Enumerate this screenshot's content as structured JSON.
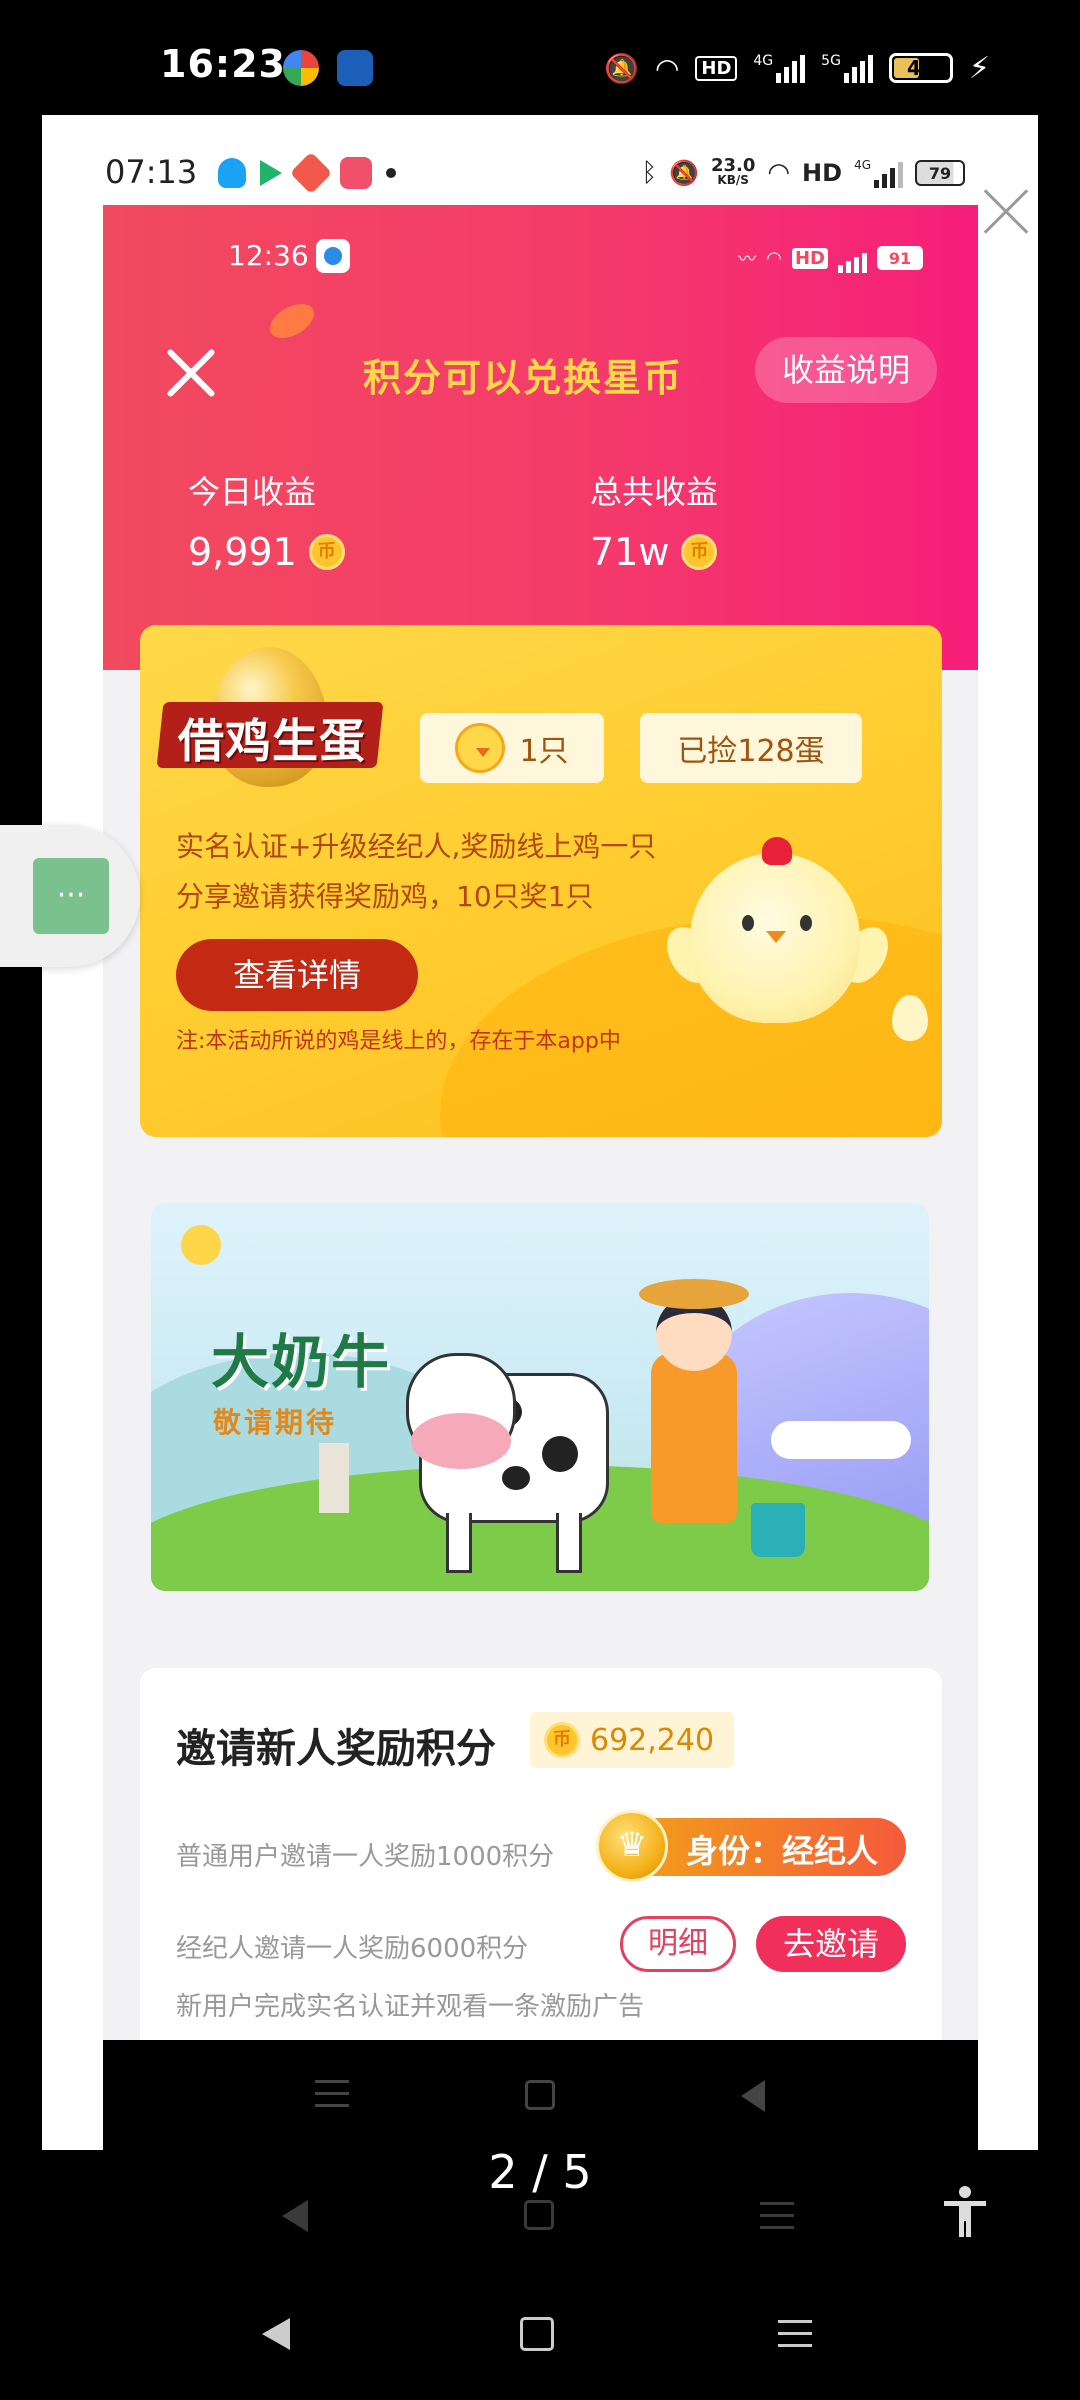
{
  "device_status": {
    "time": "16:23",
    "hd_label": "HD",
    "net_4g": "4G",
    "net_5g": "5G",
    "battery": "46"
  },
  "nested_status": {
    "time": "07:13",
    "speed": "23.0",
    "speed_unit": "KB/S",
    "hd_label": "HD",
    "net": "4G",
    "battery": "79"
  },
  "app_status": {
    "time": "12:36",
    "battery": "91"
  },
  "header": {
    "title": "积分可以兑换星币",
    "earnings_button": "收益说明"
  },
  "stats": {
    "today_label": "今日收益",
    "today_value": "9,991",
    "total_label": "总共收益",
    "total_value": "71w",
    "coin_glyph": "币"
  },
  "egg_card": {
    "title": "借鸡生蛋",
    "chicks": "1只",
    "eggs": "已捡128蛋",
    "line1": "实名认证+升级经纪人,奖励线上鸡一只",
    "line2": "分享邀请获得奖励鸡，10只奖1只",
    "detail_button": "查看详情",
    "note": "注:本活动所说的鸡是线上的，存在于本app中"
  },
  "cow_card": {
    "title": "大奶牛",
    "subtitle": "敬请期待"
  },
  "invite_card": {
    "title": "邀请新人奖励积分",
    "points": "692,240",
    "line1": "普通用户邀请一人奖励1000积分",
    "line2": "经纪人邀请一人奖励6000积分",
    "line3": "新用户完成实名认证并观看一条激励广告",
    "identity": "身份：经纪人",
    "details_button": "明细",
    "invite_button": "去邀请"
  },
  "side_button": {
    "label": "···"
  },
  "viewer": {
    "page_indicator": "2 / 5"
  },
  "colors": {
    "header_start": "#f24a5e",
    "header_end": "#f61e7a",
    "title_gold": "#ffd84a",
    "invite_button": "#f0305a",
    "detail_button": "#c22a14"
  }
}
